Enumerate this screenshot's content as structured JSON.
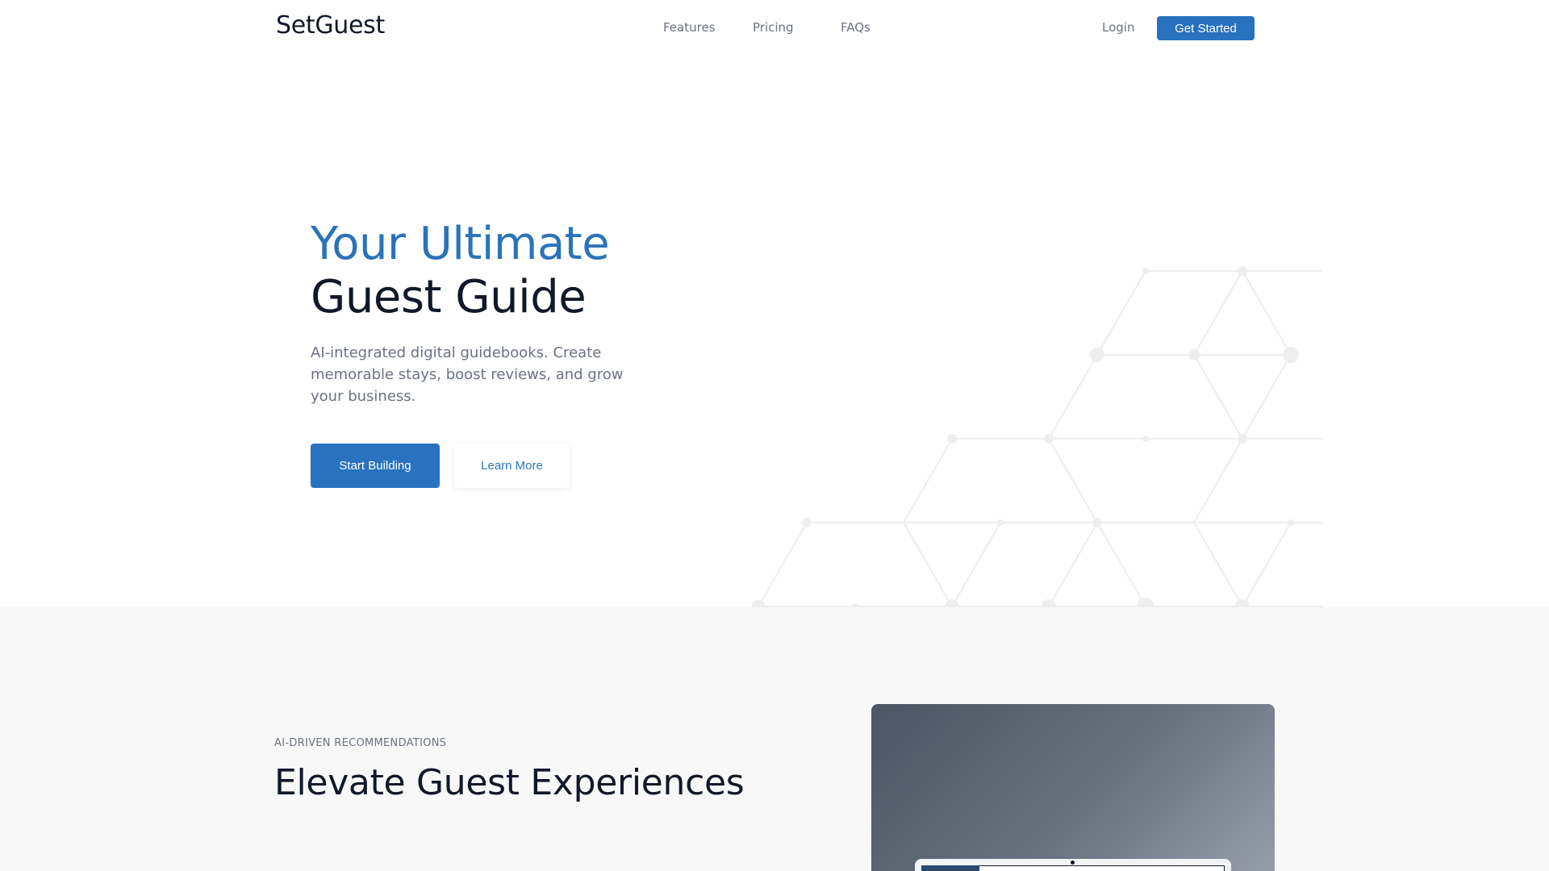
{
  "brand": {
    "name": "SetGuest"
  },
  "nav": {
    "links": [
      "Features",
      "Pricing",
      "FAQs"
    ],
    "login": "Login",
    "cta": "Get Started"
  },
  "hero": {
    "title_accent": "Your Ultimate",
    "title_main": "Guest Guide",
    "subtitle": "AI-integrated digital guidebooks. Create memorable stays, boost reviews, and grow your business.",
    "primary_button": "Start Building",
    "secondary_button": "Learn More"
  },
  "features": {
    "eyebrow": "AI-DRIVEN RECOMMENDATIONS",
    "title": "Elevate Guest Experiences"
  },
  "colors": {
    "accent": "#2b73b9",
    "button": "#2872bf",
    "text_dark": "#111827",
    "text_muted": "#6b7280",
    "section_bg": "#f8f8f8"
  }
}
